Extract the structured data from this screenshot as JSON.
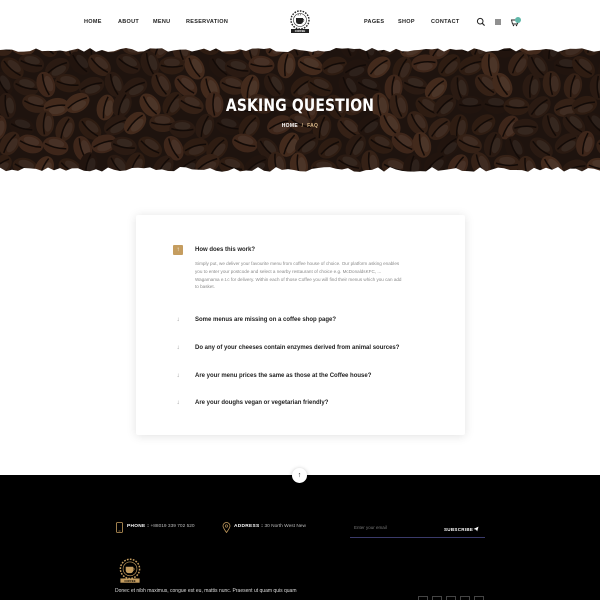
{
  "nav": {
    "left": [
      "HOME",
      "ABOUT",
      "MENU",
      "RESERVATION"
    ],
    "right": [
      "PAGES",
      "SHOP",
      "CONTACT"
    ],
    "icons": [
      "search-icon",
      "menu-icon",
      "cart-icon"
    ]
  },
  "logo": {
    "text": "COFFEE"
  },
  "hero": {
    "title": "ASKING QUESTION",
    "breadcrumb": {
      "home": "HOME",
      "separator": "/",
      "current": "FAQ"
    }
  },
  "faq": {
    "items": [
      {
        "question": "How does this work?",
        "answer": "Simply put, we deliver your favourite menu from coffee house of choice. Our platform asking enables you to enter your postcode and select a nearby restaurant of choice e.g. McDonaldsKFC, ... Wagamama e.t.c for delivery. Within each of those Coffee you will find their menus which you can add to basket.",
        "expanded": true,
        "toggle": "↑"
      },
      {
        "question": "Some menus are missing on a coffee shop page?",
        "expanded": false,
        "toggle": "↓"
      },
      {
        "question": "Do any of your cheeses contain enzymes derived from animal sources?",
        "expanded": false,
        "toggle": "↓"
      },
      {
        "question": "Are your menu prices the same as those at the Coffee house?",
        "expanded": false,
        "toggle": "↓"
      },
      {
        "question": "Are your doughs vegan or vegetarian friendly?",
        "expanded": false,
        "toggle": "↓"
      }
    ]
  },
  "scroll_top": {
    "label": "↑"
  },
  "footer": {
    "phone_label": "PHONE :",
    "phone_value": "+88019 339 702 520",
    "address_label": "ADDRESS :",
    "address_value": "30 North West New",
    "email_placeholder": "Enter your email",
    "subscribe_label": "SUBSCRIBE",
    "about_text": "Donec et nibh maximus, congue est eu, mattis nunc. Praesent ut quam quis quam"
  },
  "colors": {
    "accent": "#c59d5f",
    "hero_dark": "#2a1b14",
    "footer_bg": "#000000",
    "cart_badge": "#5fb7a8"
  }
}
